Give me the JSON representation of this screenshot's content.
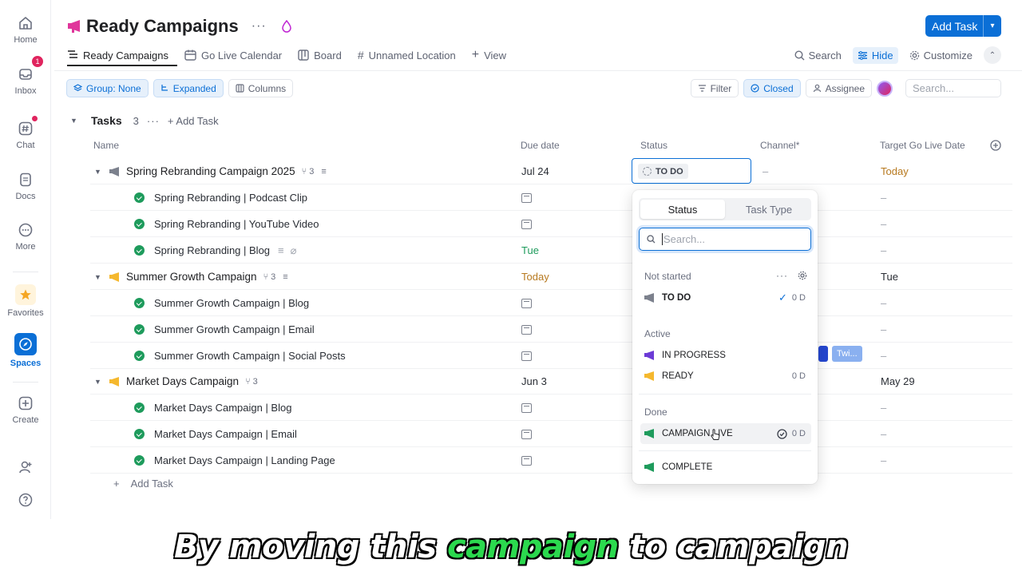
{
  "rail": {
    "items": [
      {
        "label": "Home"
      },
      {
        "label": "Inbox",
        "badge": "1"
      },
      {
        "label": "Chat"
      },
      {
        "label": "Docs"
      },
      {
        "label": "More"
      },
      {
        "label": "Favorites"
      },
      {
        "label": "Spaces"
      },
      {
        "label": "Create"
      }
    ]
  },
  "header": {
    "title": "Ready Campaigns",
    "more": "···",
    "add_task": "Add Task"
  },
  "views": {
    "tabs": [
      "Ready Campaigns",
      "Go Live Calendar",
      "Board",
      "Unnamed Location",
      "View"
    ],
    "right": {
      "search": "Search",
      "hide": "Hide",
      "customize": "Customize"
    }
  },
  "filters": {
    "group": "Group: None",
    "expanded": "Expanded",
    "columns": "Columns",
    "filter": "Filter",
    "closed": "Closed",
    "assignee": "Assignee",
    "search_placeholder": "Search..."
  },
  "group": {
    "name": "Tasks",
    "count": "3",
    "more": "···",
    "add_task": "Add Task"
  },
  "columns": {
    "name": "Name",
    "due": "Due date",
    "status": "Status",
    "channel": "Channel*",
    "target": "Target Go Live Date"
  },
  "rows": [
    {
      "name": "Spring Rebranding Campaign 2025",
      "sub": "3",
      "due": "Jul 24",
      "status": "TO DO",
      "channel": "–",
      "target": "Today"
    },
    {
      "name": "Spring Rebranding | Podcast Clip",
      "target": "–"
    },
    {
      "name": "Spring Rebranding | YouTube Video",
      "target": "–"
    },
    {
      "name": "Spring Rebranding | Blog",
      "due": "Tue",
      "target": "–"
    },
    {
      "name": "Summer Growth Campaign",
      "sub": "3",
      "due": "Today",
      "target": "Tue"
    },
    {
      "name": "Summer Growth Campaign | Blog",
      "target": "–"
    },
    {
      "name": "Summer Growth Campaign | Email",
      "target": "–"
    },
    {
      "name": "Summer Growth Campaign | Social Posts",
      "target": "–",
      "tag": "Twi..."
    },
    {
      "name": "Market Days Campaign",
      "sub": "3",
      "due": "Jun 3",
      "target": "May 29"
    },
    {
      "name": "Market Days Campaign | Blog",
      "target": "–"
    },
    {
      "name": "Market Days Campaign | Email",
      "target": "–"
    },
    {
      "name": "Market Days Campaign | Landing Page",
      "target": "–"
    }
  ],
  "add_task_bottom": "Add Task",
  "dropdown": {
    "tabs": [
      "Status",
      "Task Type"
    ],
    "search_placeholder": "Search...",
    "sections": {
      "not_started": "Not started",
      "active": "Active",
      "done": "Done"
    },
    "items": {
      "todo": {
        "label": "TO DO",
        "count": "0 D"
      },
      "in_progress": {
        "label": "IN PROGRESS"
      },
      "ready": {
        "label": "READY",
        "count": "0 D"
      },
      "campaign_live": {
        "label": "CAMPAIGN LIVE",
        "count": "0 D"
      },
      "complete": {
        "label": "COMPLETE"
      }
    },
    "more": "···"
  },
  "caption": {
    "part1": "By moving this ",
    "highlight": "campaign",
    "part2": " to campaign"
  },
  "colors": {
    "accent": "#0b6fd6",
    "done_green": "#1e9b5c",
    "ready_yellow": "#f5b82e",
    "progress_purple": "#6c3bd6",
    "title_pink": "#e0359b"
  }
}
